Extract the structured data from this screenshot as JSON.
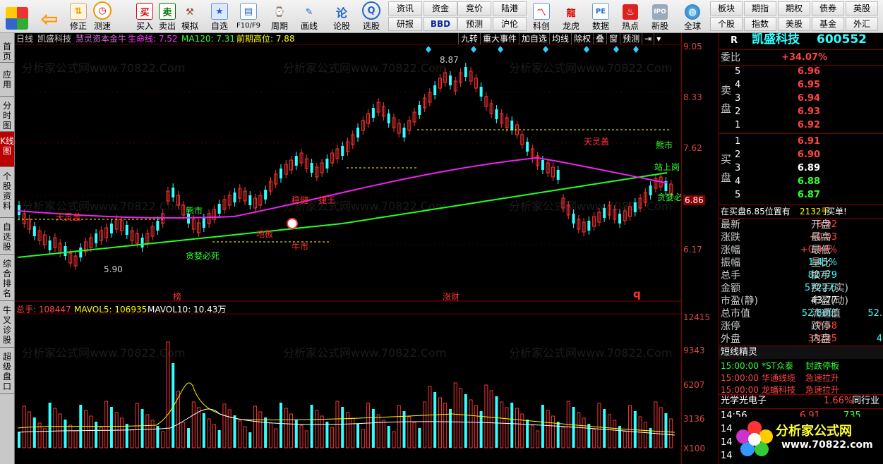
{
  "toolbar": {
    "left_buttons": [
      {
        "label": "修正",
        "icon": "up-down-arrows-icon"
      },
      {
        "label": "测速",
        "icon": "clock-icon"
      },
      {
        "label": "买入",
        "icon": "buy-icon"
      },
      {
        "label": "卖出",
        "icon": "sell-icon"
      },
      {
        "label": "模拟",
        "icon": "hammer-icon"
      },
      {
        "label": "自选",
        "icon": "star-icon"
      },
      {
        "label": "F10/F9",
        "icon": "f10-icon"
      },
      {
        "label": "周期",
        "icon": "period-icon"
      },
      {
        "label": "画线",
        "icon": "pencil-icon"
      },
      {
        "label": "论股",
        "icon": "forum-icon"
      },
      {
        "label": "选股",
        "icon": "stock-pick-icon"
      }
    ],
    "grid_buttons_1": [
      "资讯",
      "资金",
      "研报",
      "BBD"
    ],
    "grid_buttons_2": [
      "竞价",
      "陆港",
      "预测",
      "沪伦"
    ],
    "mid_buttons": [
      {
        "label": "科创",
        "icon": "chart-icon"
      },
      {
        "label": "龙虎",
        "icon": "dragon-icon"
      },
      {
        "label": "数据",
        "icon": "pe-icon"
      },
      {
        "label": "热点",
        "icon": "hot-icon"
      },
      {
        "label": "新股",
        "icon": "ipo-icon"
      },
      {
        "label": "全球",
        "icon": "globe-icon"
      }
    ],
    "right_grid": [
      "板块",
      "期指",
      "期权",
      "债券",
      "英股",
      "个股",
      "指数",
      "美股",
      "基金",
      "外汇"
    ]
  },
  "left_tabs": [
    "首页",
    "应用",
    "分时图",
    "K线图",
    "个股资料",
    "自选股",
    "综合排名",
    "牛叉诊股",
    "超级盘口"
  ],
  "chart_header": {
    "period": "日线",
    "name": "凯盛科技",
    "indicator": "慧灵资本金牛",
    "lifeline": "生命线: 7.52",
    "ma120": "MA120: 7.31",
    "prev_high": "前期高位: 7.88"
  },
  "chart_buttons": [
    "九转",
    "重大事件",
    "加自选",
    "均线",
    "除权",
    "叠",
    "窗",
    "预测"
  ],
  "volume_header": {
    "total": "总手: 108447",
    "mavol5": "MAVOL5: 106935",
    "mavol10": "MAVOL10: 10.43万"
  },
  "chart_annotations": [
    "8.87",
    "5.90",
    "天灵盖",
    "熊市",
    "贪婪必死",
    "地板",
    "稳健",
    "牛市",
    "捷王",
    "天灵盖",
    "熊市",
    "站上岗",
    "贪婪必",
    "榜",
    "涨财",
    "q"
  ],
  "price_axis": [
    "9.05",
    "8.33",
    "7.62",
    "6.86",
    "6.17"
  ],
  "volume_axis": [
    "12415",
    "9343",
    "6207",
    "3136",
    "X100"
  ],
  "watermark": "分析家公式网www.70822.Com",
  "panel": {
    "header_r": "R",
    "stock_name": "凯盛科技",
    "stock_code": "600552",
    "commission_ratio_label": "委比",
    "commission_ratio": "+34.07%",
    "sell_label": "卖盘",
    "buy_label": "买盘",
    "sell_orders": [
      {
        "level": "5",
        "price": "6.96"
      },
      {
        "level": "4",
        "price": "6.95"
      },
      {
        "level": "3",
        "price": "6.94"
      },
      {
        "level": "2",
        "price": "6.93"
      },
      {
        "level": "1",
        "price": "6.92"
      }
    ],
    "buy_orders": [
      {
        "level": "1",
        "price": "6.91"
      },
      {
        "level": "2",
        "price": "6.90"
      },
      {
        "level": "3",
        "price": "6.89"
      },
      {
        "level": "4",
        "price": "6.88"
      },
      {
        "level": "5",
        "price": "6.87"
      }
    ],
    "notice": "在买盘6.85位置有",
    "notice_qty": "2132手",
    "notice_tag": "买单!",
    "stats": [
      {
        "l1": "最新",
        "v1": "6.92",
        "l2": "开盘",
        "c1": "red"
      },
      {
        "l1": "涨跌",
        "v1": "+0.03",
        "l2": "最高",
        "c1": "red"
      },
      {
        "l1": "涨幅",
        "v1": "+0.44%",
        "l2": "最低",
        "c1": "red"
      },
      {
        "l1": "振幅",
        "v1": "1.45%",
        "l2": "量比",
        "c1": "cyan"
      },
      {
        "l1": "总手",
        "v1": "82779",
        "l2": "换手",
        "c1": "cyan"
      },
      {
        "l1": "金额",
        "v1": "5722万",
        "l2": "换手(实)",
        "c1": "cyan"
      },
      {
        "l1": "市盈(静)",
        "v1": "43.77",
        "l2": "市盈(动)",
        "c1": "white"
      },
      {
        "l1": "总市值",
        "v1": "52.86亿",
        "l2": "流通值",
        "c1": "cyan",
        "v2": "52."
      },
      {
        "l1": "涨停",
        "v1": "7.58",
        "l2": "跌停",
        "c1": "red"
      },
      {
        "l1": "外盘",
        "v1": "33285",
        "l2": "内盘",
        "c1": "red",
        "v2": "4"
      }
    ],
    "short_title": "短线精灵",
    "alerts": [
      {
        "time": "15:00:00",
        "name": "*ST众泰",
        "event": "封跌停板",
        "color": "green"
      },
      {
        "time": "15:00:00",
        "name": "华通线缆",
        "event": "急速拉升",
        "color": "red"
      },
      {
        "time": "15:00:00",
        "name": "龙蟠科技",
        "event": "急速拉升",
        "color": "red"
      }
    ],
    "industry": "光学光电子",
    "industry_pct": "1.66%",
    "industry_tag": "同行业",
    "ticks": [
      {
        "time": "14:56",
        "price": "6.91",
        "vol": "735"
      },
      {
        "time": "14:",
        "price": "",
        "vol": ""
      },
      {
        "time": "14:",
        "price": "",
        "vol": ""
      },
      {
        "time": "14:",
        "price": "",
        "vol": ""
      }
    ],
    "logo_text": "分析家公式网",
    "logo_url": "www.70822.com"
  }
}
